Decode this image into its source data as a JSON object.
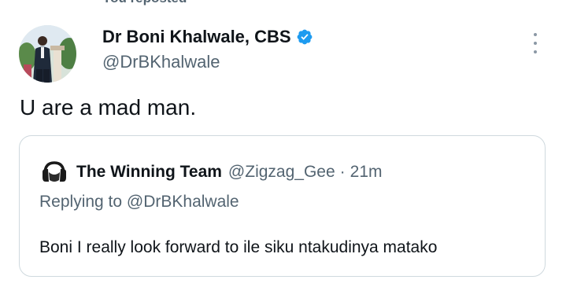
{
  "context": {
    "retweet_text": "You reposted"
  },
  "tweet": {
    "author": {
      "name": "Dr Boni Khalwale, CBS",
      "handle": "@DrBKhalwale",
      "verified": true,
      "avatar_icon": "avatar-photo"
    },
    "text": "U are a mad man.",
    "more_icon": "more-vertical-icon"
  },
  "quoted_tweet": {
    "author": {
      "name": "The Winning Team",
      "handle": "@Zigzag_Gee",
      "avatar_icon": "headphones-avatar"
    },
    "separator": "·",
    "time": "21m",
    "replying_to": "Replying to @DrBKhalwale",
    "text": "Boni I really look forward to ile siku ntakudinya matako"
  },
  "colors": {
    "text_primary": "#0f1419",
    "text_secondary": "#536471",
    "verified_blue": "#1d9bf0",
    "border": "#cfd9de"
  }
}
